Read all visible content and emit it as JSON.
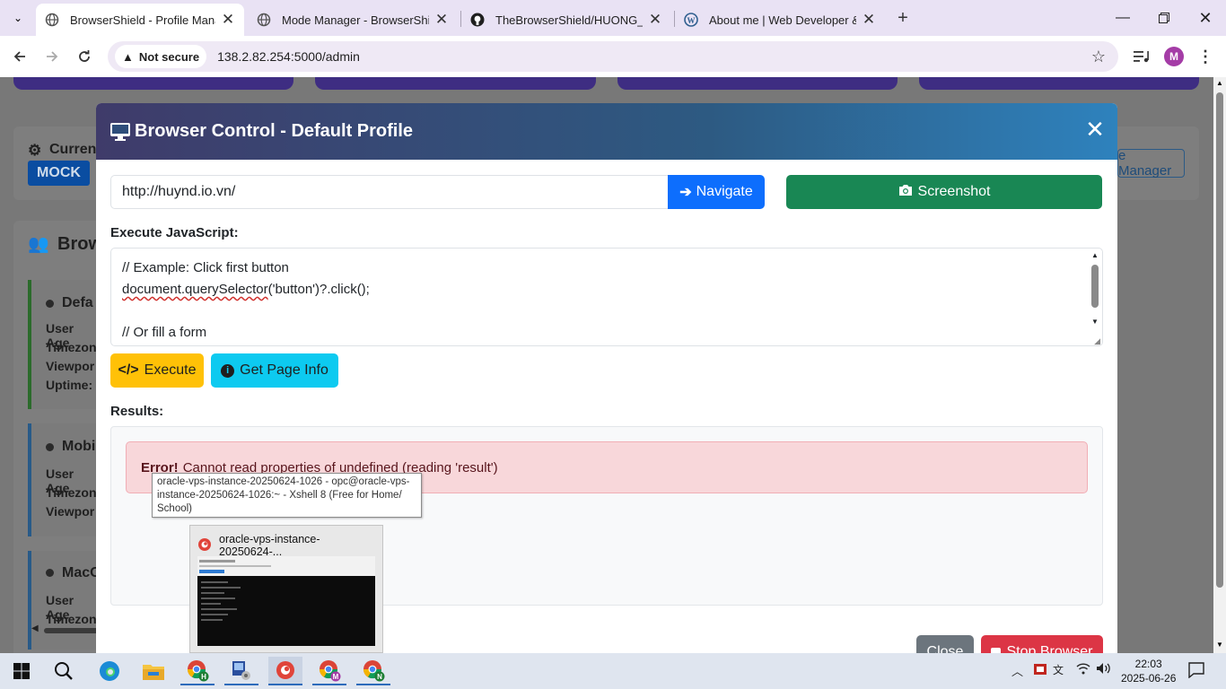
{
  "browser": {
    "tabs": [
      {
        "title": "BrowserShield - Profile Manage",
        "active": true,
        "icon": "globe-icon"
      },
      {
        "title": "Mode Manager - BrowserShield",
        "active": false,
        "icon": "globe-icon"
      },
      {
        "title": "TheBrowserShield/HUONG_DA",
        "active": false,
        "icon": "github-icon"
      },
      {
        "title": "About me | Web Developer & D",
        "active": false,
        "icon": "wordpress-icon"
      }
    ],
    "security_label": "Not secure",
    "url": "138.2.82.254:5000/admin",
    "profile_initial": "M"
  },
  "background_page": {
    "current_label": "Curren",
    "mode_badge": "MOCK",
    "manager_button": "e Manager",
    "section_title": "Brow",
    "profiles": [
      {
        "name": "Defa",
        "lines": [
          "User Age",
          "Timezon",
          "Viewpor",
          "Uptime:"
        ]
      },
      {
        "name": "Mobi",
        "lines": [
          "User Age",
          "Timezon",
          "Viewpor"
        ]
      },
      {
        "name": "MacO",
        "lines": [
          "User Age",
          "Timezon"
        ]
      }
    ]
  },
  "modal": {
    "title": "Browser Control - Default Profile",
    "url_value": "http://huynd.io.vn/",
    "navigate_label": "Navigate",
    "screenshot_label": "Screenshot",
    "execute_js_label": "Execute JavaScript:",
    "code_lines": [
      "// Example: Click first button",
      "document.querySelector('button')?.click();",
      "",
      "// Or fill a form"
    ],
    "execute_label": "Execute",
    "page_info_label": "Get Page Info",
    "results_label": "Results:",
    "error_prefix": "Error!",
    "error_message": "Cannot read properties of undefined (reading 'result')",
    "close_label": "Close",
    "stop_label": "Stop Browser"
  },
  "taskbar_preview": {
    "tooltip": "oracle-vps-instance-20250624-1026 - opc@oracle-vps-instance-20250624-1026:~ - Xshell 8 (Free for Home/ School)",
    "window_title": "oracle-vps-instance-20250624-..."
  },
  "taskbar": {
    "time": "22:03",
    "date": "2025-06-26",
    "apps": [
      "start-icon",
      "search-icon",
      "edge-icon",
      "file-explorer-icon",
      "chrome-profile-h-icon",
      "network-tool-icon",
      "xshell-icon",
      "chrome-profile-m-icon",
      "chrome-profile-n-icon"
    ]
  },
  "colors": {
    "modal_header_start": "#3f3b6a",
    "modal_header_end": "#2e82bd",
    "navigate": "#0d6efd",
    "screenshot": "#198754",
    "execute": "#ffc107",
    "page_info": "#0dcaf0",
    "error_bg": "#f8d7da",
    "stop": "#dc3545"
  }
}
